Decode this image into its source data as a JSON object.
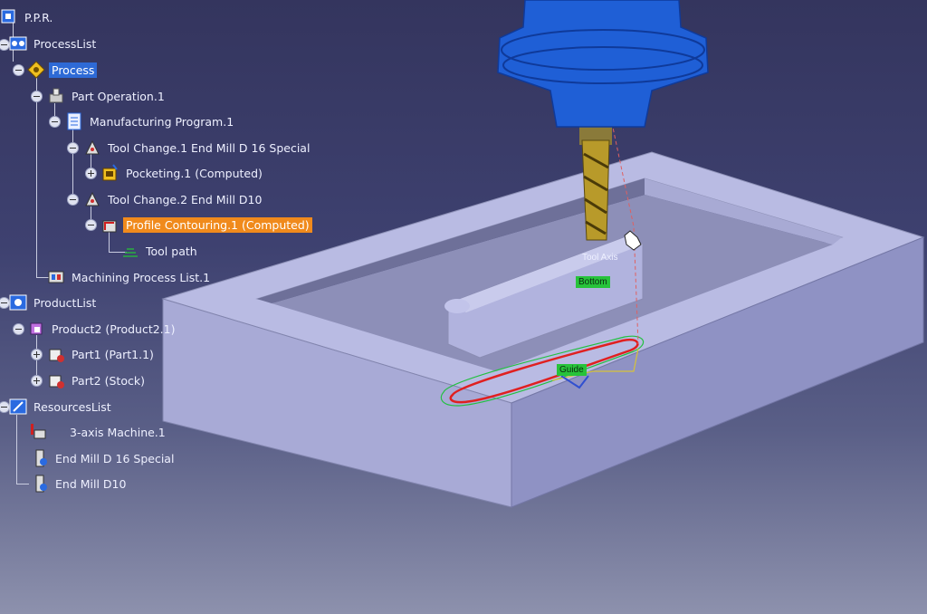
{
  "tree": {
    "items": [
      {
        "label": "P.P.R."
      },
      {
        "label": "ProcessList"
      },
      {
        "label": "Process"
      },
      {
        "label": "Part Operation.1"
      },
      {
        "label": "Manufacturing Program.1"
      },
      {
        "label": "Tool Change.1  End Mill D 16 Special"
      },
      {
        "label": "Pocketing.1 (Computed)"
      },
      {
        "label": "Tool Change.2  End Mill D10"
      },
      {
        "label": "Profile Contouring.1 (Computed)"
      },
      {
        "label": "Tool path"
      },
      {
        "label": "Machining Process List.1"
      },
      {
        "label": "ProductList"
      },
      {
        "label": "Product2 (Product2.1)"
      },
      {
        "label": "Part1 (Part1.1)"
      },
      {
        "label": "Part2 (Stock)"
      },
      {
        "label": "ResourcesList"
      },
      {
        "label": "3-axis Machine.1"
      },
      {
        "label": "End Mill D 16 Special"
      },
      {
        "label": "End Mill D10"
      }
    ]
  },
  "viewport": {
    "labels": {
      "tool_axis": "Tool Axis",
      "bottom": "Bottom",
      "guide": "Guide"
    }
  },
  "colors": {
    "selection": "#2e6ad6",
    "computed_highlight": "#f08a1c",
    "part_face": "#b7b9e2",
    "tool_holder": "#1f5fd6",
    "end_mill": "#b89a2a",
    "toolpath": "#e02020",
    "label_green": "#27c33a"
  }
}
